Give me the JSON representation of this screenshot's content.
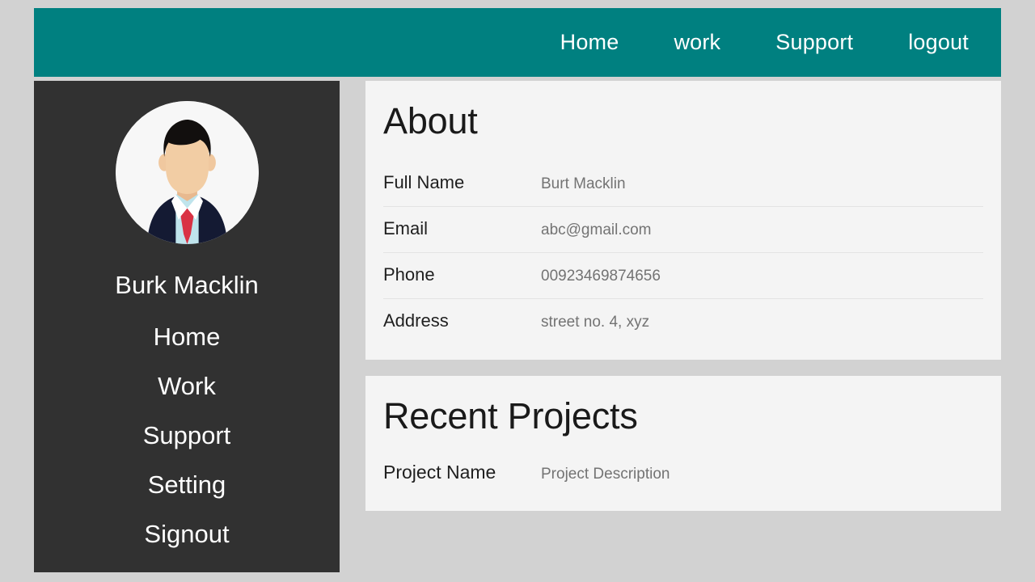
{
  "topnav": {
    "links": [
      {
        "label": "Home",
        "name": "nav-home"
      },
      {
        "label": "work",
        "name": "nav-work"
      },
      {
        "label": "Support",
        "name": "nav-support"
      },
      {
        "label": "logout",
        "name": "nav-logout"
      }
    ]
  },
  "sidebar": {
    "avatar_icon": "user-avatar-businessman-icon",
    "name": "Burk Macklin",
    "menu": [
      {
        "label": "Home"
      },
      {
        "label": "Work"
      },
      {
        "label": "Support"
      },
      {
        "label": "Setting"
      },
      {
        "label": "Signout"
      }
    ]
  },
  "about": {
    "title": "About",
    "rows": [
      {
        "label": "Full Name",
        "value": "Burt Macklin"
      },
      {
        "label": "Email",
        "value": "abc@gmail.com"
      },
      {
        "label": "Phone",
        "value": "00923469874656"
      },
      {
        "label": "Address",
        "value": "street no. 4, xyz"
      }
    ]
  },
  "projects": {
    "title": "Recent Projects",
    "rows": [
      {
        "label": "Project Name",
        "value": "Project Description"
      }
    ]
  },
  "colors": {
    "accent_teal": "#008080",
    "sidebar_dark": "#313131",
    "page_bg": "#d2d2d2",
    "card_bg": "#f4f4f4",
    "value_gray": "#737373"
  }
}
